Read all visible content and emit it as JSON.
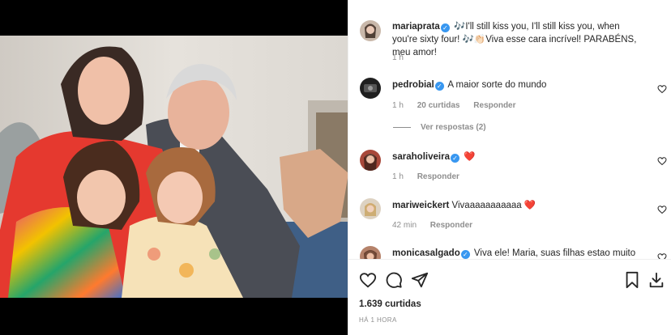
{
  "post": {
    "caption_user": "mariaprata",
    "caption_text": "🎶I'll still kiss you, I'll still kiss you, when you're sixty four! 🎶👏🏻Viva esse cara incrível! PARABÉNS, meu amor!",
    "caption_time": "1 h"
  },
  "comments": [
    {
      "user": "pedrobial",
      "verified": true,
      "text": "A maior sorte do mundo",
      "time": "1 h",
      "likes": "20 curtidas",
      "reply": "Responder"
    },
    {
      "user": "saraholiveira",
      "verified": true,
      "text": "❤️",
      "time": "1 h",
      "reply": "Responder"
    },
    {
      "user": "mariweickert",
      "verified": false,
      "text": "Vivaaaaaaaaaaa ❤️",
      "time": "42 min",
      "reply": "Responder"
    },
    {
      "user": "monicasalgado",
      "verified": true,
      "text": "Viva ele! Maria, suas filhas estao muito"
    }
  ],
  "view_replies": "Ver respostas (2)",
  "likes_count": "1.639 curtidas",
  "post_time": "HÁ 1 HORA",
  "icons": [
    "heart-icon",
    "comment-icon",
    "share-icon",
    "bookmark-icon",
    "download-icon"
  ]
}
